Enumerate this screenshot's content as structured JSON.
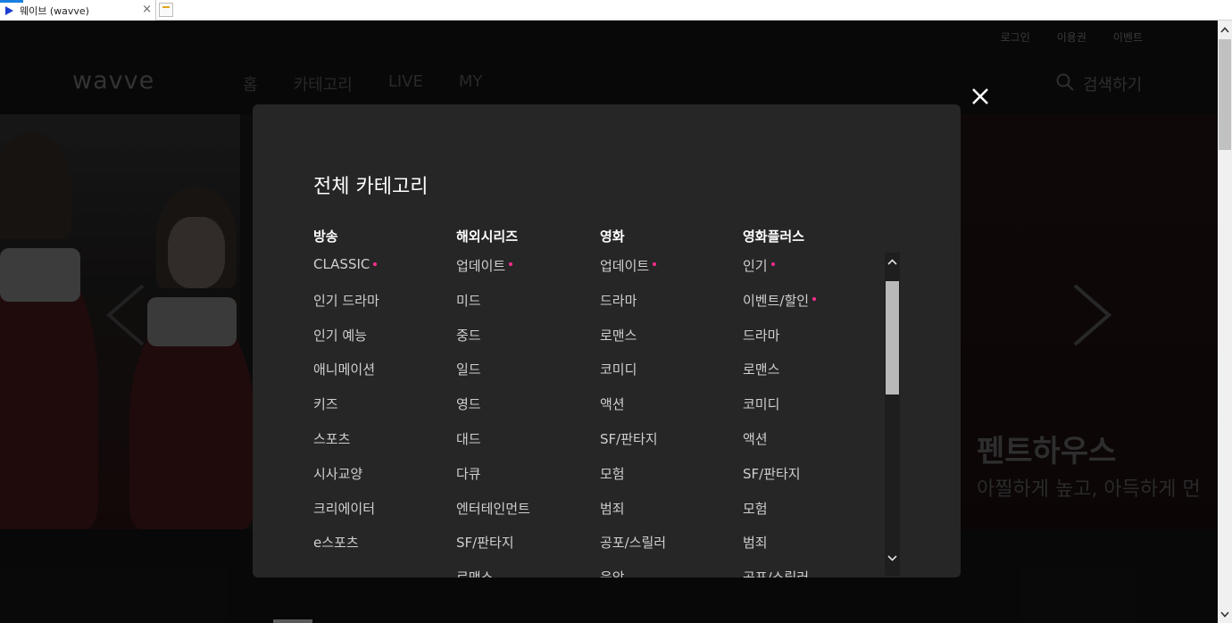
{
  "browser": {
    "tab_title": "웨이브 (wavve)"
  },
  "header": {
    "logo": "wavve",
    "util_links": [
      "로그인",
      "이용권",
      "이벤트"
    ],
    "nav": [
      "홈",
      "카테고리",
      "LIVE",
      "MY"
    ],
    "search_label": "검색하기"
  },
  "hero": {
    "title": "펜트하우스",
    "subtitle": "아찔하게 높고, 아득하게 먼"
  },
  "modal": {
    "title": "전체 카테고리",
    "columns": [
      {
        "heading": "방송",
        "items": [
          {
            "label": "CLASSIC",
            "new": true
          },
          {
            "label": "인기 드라마",
            "new": false
          },
          {
            "label": "인기 예능",
            "new": false
          },
          {
            "label": "애니메이션",
            "new": false
          },
          {
            "label": "키즈",
            "new": false
          },
          {
            "label": "스포츠",
            "new": false
          },
          {
            "label": "시사교양",
            "new": false
          },
          {
            "label": "크리에이터",
            "new": false
          },
          {
            "label": "e스포츠",
            "new": false
          }
        ]
      },
      {
        "heading": "해외시리즈",
        "items": [
          {
            "label": "업데이트",
            "new": true
          },
          {
            "label": "미드",
            "new": false
          },
          {
            "label": "중드",
            "new": false
          },
          {
            "label": "일드",
            "new": false
          },
          {
            "label": "영드",
            "new": false
          },
          {
            "label": "대드",
            "new": false
          },
          {
            "label": "다큐",
            "new": false
          },
          {
            "label": "엔터테인먼트",
            "new": false
          },
          {
            "label": "SF/판타지",
            "new": false
          },
          {
            "label": "로맨스",
            "new": false
          }
        ]
      },
      {
        "heading": "영화",
        "items": [
          {
            "label": "업데이트",
            "new": true
          },
          {
            "label": "드라마",
            "new": false
          },
          {
            "label": "로맨스",
            "new": false
          },
          {
            "label": "코미디",
            "new": false
          },
          {
            "label": "액션",
            "new": false
          },
          {
            "label": "SF/판타지",
            "new": false
          },
          {
            "label": "모험",
            "new": false
          },
          {
            "label": "범죄",
            "new": false
          },
          {
            "label": "공포/스릴러",
            "new": false
          },
          {
            "label": "음악",
            "new": false
          }
        ]
      },
      {
        "heading": "영화플러스",
        "items": [
          {
            "label": "인기",
            "new": true
          },
          {
            "label": "이벤트/할인",
            "new": true
          },
          {
            "label": "드라마",
            "new": false
          },
          {
            "label": "로맨스",
            "new": false
          },
          {
            "label": "코미디",
            "new": false
          },
          {
            "label": "액션",
            "new": false
          },
          {
            "label": "SF/판타지",
            "new": false
          },
          {
            "label": "모험",
            "new": false
          },
          {
            "label": "범죄",
            "new": false
          },
          {
            "label": "공포/스릴러",
            "new": false
          }
        ]
      }
    ]
  },
  "colors": {
    "accent_dot": "#ff2d8f",
    "modal_bg": "#262626",
    "pager_active": "#1a3fcf"
  },
  "icons": [
    "favicon-play-icon",
    "close-icon",
    "search-icon",
    "chevron-left-icon",
    "chevron-right-icon",
    "chevron-up-icon",
    "chevron-down-icon"
  ]
}
